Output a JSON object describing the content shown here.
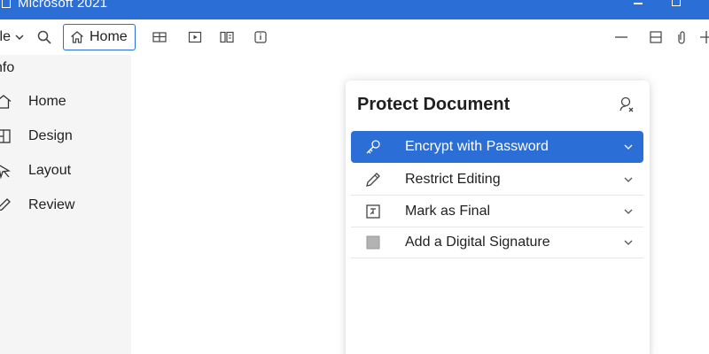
{
  "window": {
    "title": "Microsoft  2021"
  },
  "toolbar": {
    "file_label": "ile",
    "home_label": "Home",
    "icons": [
      "chevron-down-icon",
      "search-icon",
      "home-icon",
      "table-icon",
      "play-icon",
      "compare-icon",
      "info-icon",
      "minimize-icon",
      "split-icon",
      "attach-icon",
      "plus-icon"
    ]
  },
  "sidebar": {
    "section_label": "nfo",
    "items": [
      {
        "label": "Home",
        "icon": "home-icon"
      },
      {
        "label": "Design",
        "icon": "design-icon"
      },
      {
        "label": "Layout",
        "icon": "layout-icon"
      },
      {
        "label": "Review",
        "icon": "review-icon"
      }
    ]
  },
  "panel": {
    "title": "Protect Document",
    "options": [
      {
        "label": "Encrypt with Password",
        "icon": "key-icon",
        "selected": true
      },
      {
        "label": "Restrict Editing",
        "icon": "pencil-icon",
        "selected": false
      },
      {
        "label": "Mark as Final",
        "icon": "mark-final-icon",
        "selected": false
      },
      {
        "label": "Add a Digital Signature",
        "icon": "signature-icon",
        "selected": false
      }
    ]
  },
  "colors": {
    "accent": "#2b6fd6",
    "sidebar_bg": "#f5f5f5",
    "selected_text": "#ffffff"
  }
}
